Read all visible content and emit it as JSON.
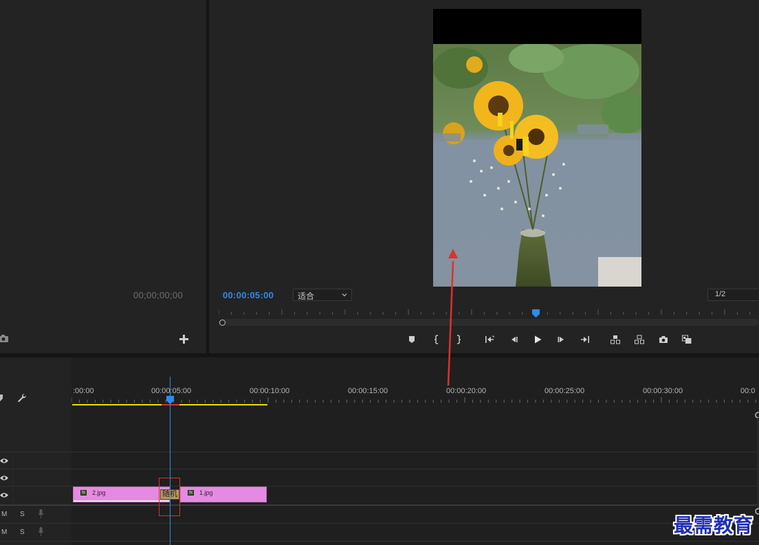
{
  "source_monitor": {
    "timecode": "00;00;00;00"
  },
  "program_monitor": {
    "timecode": "00:00:05:00",
    "zoom_value": "适合",
    "resolution_value": "1/2"
  },
  "timeline": {
    "ruler_labels": [
      ":00:00",
      "00:00:05:00",
      "00:00:10:00",
      "00:00:15:00",
      "00:00:20:00",
      "00:00:25:00",
      "00:00:30:00",
      "00:0"
    ],
    "tracks": {
      "audio_1": {
        "mute": "M",
        "solo": "S"
      },
      "audio_2": {
        "mute": "M",
        "solo": "S"
      }
    },
    "clips": [
      {
        "name": "2.jpg",
        "fx": "fx"
      },
      {
        "name": "1.jpg",
        "fx": "fx"
      }
    ],
    "transition_label": "随机"
  },
  "watermark": "最需教育",
  "colors": {
    "accent_blue": "#2d8ceb",
    "clip_pink": "#e58ae2",
    "workarea_yellow": "#e8e000",
    "annotation_red": "#e0302a",
    "watermark_blue": "#1f2fb0"
  },
  "icons": {
    "transport": [
      "marker-icon",
      "mark-in-icon",
      "mark-out-icon",
      "go-to-in-icon",
      "step-back-icon",
      "play-icon",
      "step-forward-icon",
      "go-to-out-icon",
      "lift-icon",
      "extract-icon",
      "camera-icon",
      "compare-view-icon"
    ]
  }
}
